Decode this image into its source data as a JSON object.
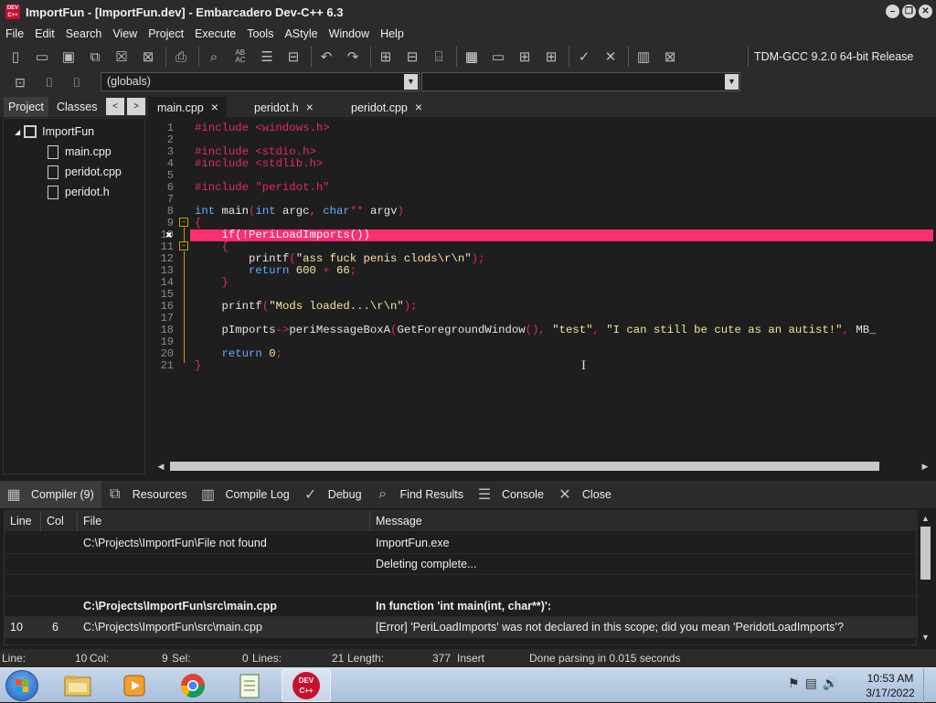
{
  "window": {
    "logo": "DEV C++",
    "title": "ImportFun - [ImportFun.dev] - Embarcadero Dev-C++ 6.3",
    "controls": [
      "minimize-icon",
      "restore-icon",
      "close-icon"
    ]
  },
  "menu": [
    "File",
    "Edit",
    "Search",
    "View",
    "Project",
    "Execute",
    "Tools",
    "AStyle",
    "Window",
    "Help"
  ],
  "compiler_select": "TDM-GCC 9.2.0 64-bit Release",
  "scope_select": "(globals)",
  "left_tabs": {
    "project": "Project",
    "classes": "Classes",
    "prev": "<",
    "next": ">"
  },
  "tree": {
    "project": "ImportFun",
    "files": [
      "main.cpp",
      "peridot.cpp",
      "peridot.h"
    ]
  },
  "editor_tabs": [
    {
      "label": "main.cpp",
      "close": "×"
    },
    {
      "label": "peridot.h",
      "close": "×"
    },
    {
      "label": "peridot.cpp",
      "close": "×"
    }
  ],
  "gutter": [
    "1",
    "2",
    "3",
    "4",
    "5",
    "6",
    "7",
    "8",
    "9",
    "10",
    "11",
    "12",
    "13",
    "14",
    "15",
    "16",
    "17",
    "18",
    "19",
    "20",
    "21"
  ],
  "code_lines": [
    "#include <windows.h>",
    "",
    "#include <stdio.h>",
    "#include <stdlib.h>",
    "",
    "#include \"peridot.h\"",
    "",
    "int main(int argc, char** argv)",
    "{",
    "    if(!PeriLoadImports())",
    "    {",
    "        printf(\"ass fuck penis clods\\r\\n\");",
    "        return 600 + 66;",
    "    }",
    "",
    "    printf(\"Mods loaded...\\r\\n\");",
    "",
    "    pImports->periMessageBoxA(GetForegroundWindow(), \"test\", \"I can still be cute as an autist!\", MB_",
    "",
    "    return 0;",
    "}"
  ],
  "bottom_tabs": [
    "Compiler (9)",
    "Resources",
    "Compile Log",
    "Debug",
    "Find Results",
    "Console",
    "Close"
  ],
  "results": {
    "headers": [
      "Line",
      "Col",
      "File",
      "Message"
    ],
    "rows": [
      {
        "line": "",
        "col": "",
        "file": "C:\\Projects\\ImportFun\\File not found",
        "message": "ImportFun.exe"
      },
      {
        "line": "",
        "col": "",
        "file": "",
        "message": "Deleting complete..."
      },
      {
        "line": "",
        "col": "",
        "file": "",
        "message": ""
      },
      {
        "line": "",
        "col": "",
        "file": "C:\\Projects\\ImportFun\\src\\main.cpp",
        "message": "In function 'int main(int, char**)':"
      },
      {
        "line": "10",
        "col": "6",
        "file": "C:\\Projects\\ImportFun\\src\\main.cpp",
        "message": "[Error] 'PeriLoadImports' was not declared in this scope; did you mean 'PeridotLoadImports'?"
      }
    ]
  },
  "status": {
    "line_label": "Line:",
    "line_val": "10",
    "col_label": "Col:",
    "col_val": "9",
    "sel_label": "Sel:",
    "sel_val": "0",
    "lines_label": "Lines:",
    "lines_val": "21",
    "length_label": "Length:",
    "length_val": "377",
    "mode": "Insert",
    "message": "Done parsing in 0.015 seconds"
  },
  "taskbar": {
    "apps": [
      "file-explorer-icon",
      "media-player-icon",
      "chrome-icon",
      "notepad-icon",
      "devcpp-icon"
    ],
    "devcpp_label": "DEV C++",
    "time": "10:53 AM",
    "date": "3/17/2022"
  },
  "colors": {
    "error_line": "#ff2e70",
    "preprocessor": "#e32b62",
    "keyword": "#6aa9ff",
    "string": "#f5e79e"
  }
}
